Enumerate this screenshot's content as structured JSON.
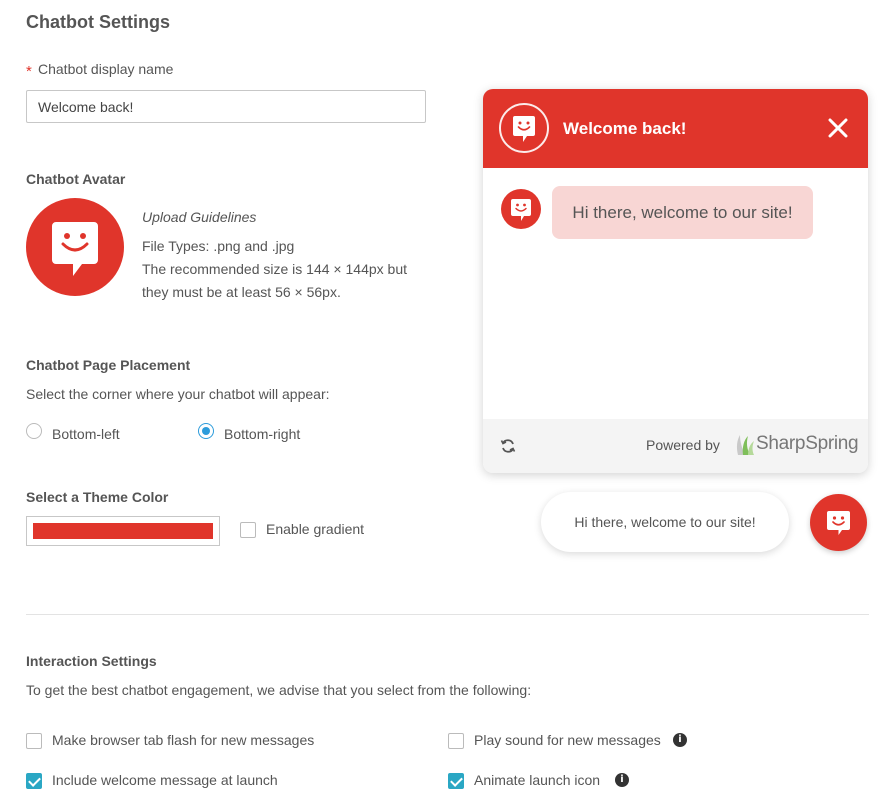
{
  "page": {
    "title": "Chatbot Settings"
  },
  "theme": {
    "color": "#e0352b",
    "light_bubble": "#f8d6d4"
  },
  "display_name": {
    "required_mark": "*",
    "label": "Chatbot display name",
    "value": "Welcome back!"
  },
  "avatar": {
    "heading": "Chatbot Avatar",
    "icon": "smiley-chat-bubble-icon",
    "guidelines_title": "Upload Guidelines",
    "file_types": "File Types: .png and .jpg",
    "size_line1": "The recommended size is 144 × 144px but",
    "size_line2": "they must be at least 56 × 56px."
  },
  "placement": {
    "heading": "Chatbot Page Placement",
    "help": "Select the corner where your chatbot will appear:",
    "options": [
      {
        "label": "Bottom-left",
        "selected": false
      },
      {
        "label": "Bottom-right",
        "selected": true
      }
    ]
  },
  "theme_color": {
    "heading": "Select a Theme Color",
    "gradient_label": "Enable gradient",
    "gradient_checked": false
  },
  "preview": {
    "header_title": "Welcome back!",
    "close_icon": "close-icon",
    "message": "Hi there, welcome to our site!",
    "refresh_icon": "refresh-icon",
    "powered_by": "Powered by",
    "brand": "SharpSpring",
    "launch_message": "Hi there, welcome to our site!"
  },
  "interaction": {
    "heading": "Interaction Settings",
    "help": "To get the best chatbot engagement, we advise that you select from the following:",
    "options": [
      {
        "label": "Make browser tab flash for new messages",
        "checked": false,
        "info": false
      },
      {
        "label": "Play sound for new messages",
        "checked": false,
        "info": true
      },
      {
        "label": "Include welcome message at launch",
        "checked": true,
        "info": false
      },
      {
        "label": "Animate launch icon",
        "checked": true,
        "info": true
      }
    ],
    "info_glyph": "i"
  }
}
